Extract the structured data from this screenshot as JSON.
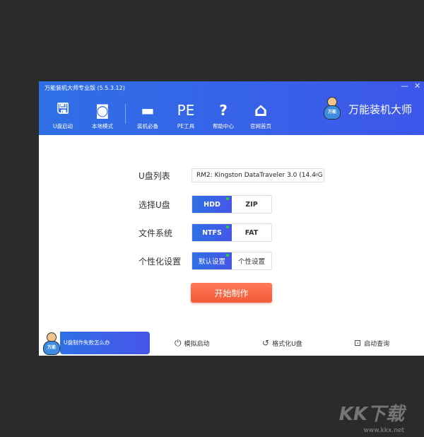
{
  "window": {
    "title": "万能装机大师专业版 (5.5.3.12)",
    "minimize": "—",
    "close": "✕"
  },
  "nav": [
    {
      "label": "U盘启动",
      "icon": "usb-drive-icon",
      "glyph": "🖫"
    },
    {
      "label": "本地模式",
      "icon": "local-disk-icon",
      "glyph": "◙"
    },
    {
      "label": "装机必备",
      "icon": "monitor-icon",
      "glyph": "▬"
    },
    {
      "label": "PE工具",
      "icon": "pe-icon",
      "glyph": "PE"
    },
    {
      "label": "帮助中心",
      "icon": "help-icon",
      "glyph": "?"
    },
    {
      "label": "官网首页",
      "icon": "home-icon",
      "glyph": "⌂"
    }
  ],
  "brand": {
    "name": "万能装机大师",
    "mascot_text": "万能"
  },
  "form": {
    "usb_list_label": "U盘列表",
    "usb_list_value": "RM2: Kingston DataTraveler 3.0 (14.4 G",
    "select_label": "选择U盘",
    "select_options": [
      "HDD",
      "ZIP"
    ],
    "fs_label": "文件系统",
    "fs_options": [
      "NTFS",
      "FAT"
    ],
    "custom_label": "个性化设置",
    "custom_options": [
      "默认设置",
      "个性设置"
    ],
    "start": "开始制作"
  },
  "footer": {
    "help": "U盘制作失败怎么办",
    "simulate": "模拟启动",
    "format": "格式化U盘",
    "query": "启动查询"
  },
  "watermark": {
    "brand": "KK下载",
    "url": "www.kkx.net"
  }
}
